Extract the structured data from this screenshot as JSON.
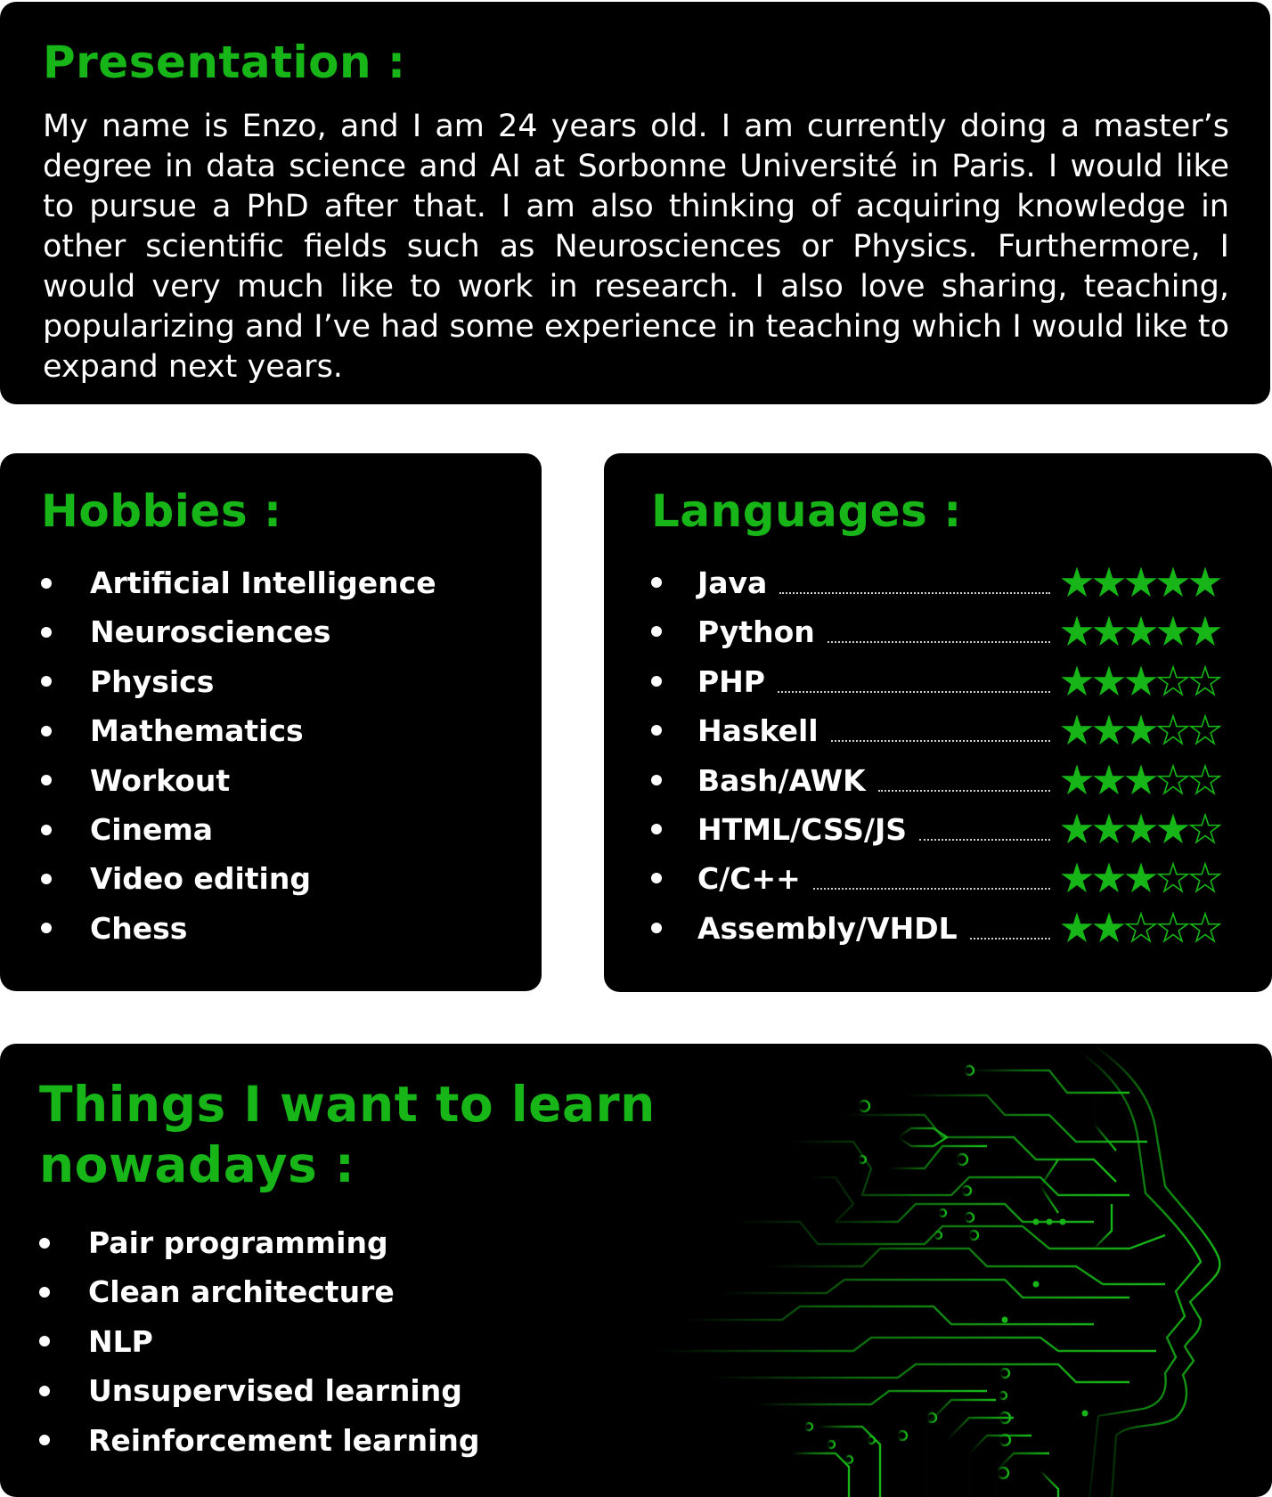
{
  "presentation": {
    "title": "Presentation :",
    "text": "My name is Enzo, and I am 24 years old. I am currently doing a master’s degree in data science and AI at Sorbonne Université in Paris. I would like to pursue a PhD after that. I am also thinking of acquiring knowledge in other scientific fields such as Neurosciences or Physics. Furthermore, I would very much like to work in research. I also love sharing, teaching, popularizing and I’ve had some experience in teaching which I would like to expand next years."
  },
  "hobbies": {
    "title": "Hobbies :",
    "items": [
      "Artificial Intelligence",
      "Neurosciences",
      "Physics",
      "Mathematics",
      "Workout",
      "Cinema",
      "Video editing",
      "Chess"
    ]
  },
  "languages": {
    "title": "Languages :",
    "max_rating": 5,
    "items": [
      {
        "name": "Java",
        "rating": 5
      },
      {
        "name": "Python",
        "rating": 5
      },
      {
        "name": "PHP",
        "rating": 3
      },
      {
        "name": "Haskell",
        "rating": 3
      },
      {
        "name": "Bash/AWK",
        "rating": 3
      },
      {
        "name": "HTML/CSS/JS",
        "rating": 4
      },
      {
        "name": "C/C++",
        "rating": 3
      },
      {
        "name": "Assembly/VHDL",
        "rating": 2
      }
    ]
  },
  "learn": {
    "title_line1": "Things I want to learn",
    "title_line2": "nowadays :",
    "items": [
      "Pair programming",
      "Clean architecture",
      "NLP",
      "Unsupervised learning",
      "Reinforcement learning"
    ]
  },
  "illustration": {
    "icon": "circuit-head-icon"
  },
  "colors": {
    "accent": "#17b517",
    "background": "#000000",
    "text": "#ffffff"
  }
}
